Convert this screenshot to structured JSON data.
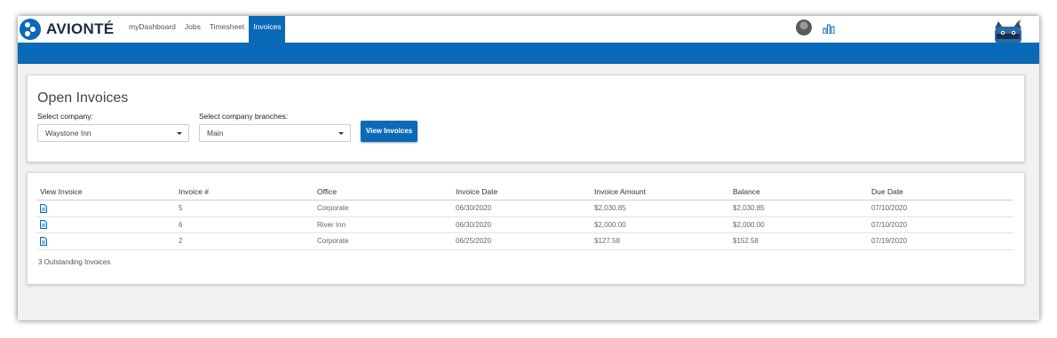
{
  "app": {
    "brand": "AVIONTÉ",
    "nav": [
      {
        "label": "myDashboard",
        "active": false
      },
      {
        "label": "Jobs",
        "active": false
      },
      {
        "label": "Timesheet",
        "active": false
      },
      {
        "label": "Invoices",
        "active": true
      }
    ],
    "accent_color": "#0b6ab8"
  },
  "filters": {
    "title": "Open Invoices",
    "company_label": "Select company:",
    "company_value": "Waystone Inn",
    "branch_label": "Select company branches:",
    "branch_value": "Main",
    "view_button": "View Invoices"
  },
  "table": {
    "headers": [
      "View Invoice",
      "Invoice #",
      "Office",
      "Invoice Date",
      "Invoice Amount",
      "Balance",
      "Due Date"
    ],
    "rows": [
      {
        "icon": "document-icon",
        "invoice": "5",
        "office": "Corporate",
        "date": "06/30/2020",
        "amount": "$2,030.85",
        "balance": "$2,030.85",
        "due": "07/10/2020"
      },
      {
        "icon": "document-icon",
        "invoice": "6",
        "office": "River Inn",
        "date": "06/30/2020",
        "amount": "$2,000.00",
        "balance": "$2,000.00",
        "due": "07/10/2020"
      },
      {
        "icon": "document-icon",
        "invoice": "2",
        "office": "Corporate",
        "date": "06/25/2020",
        "amount": "$127.58",
        "balance": "$152.58",
        "due": "07/19/2020"
      }
    ],
    "footer": "3 Outstanding Invoices"
  }
}
